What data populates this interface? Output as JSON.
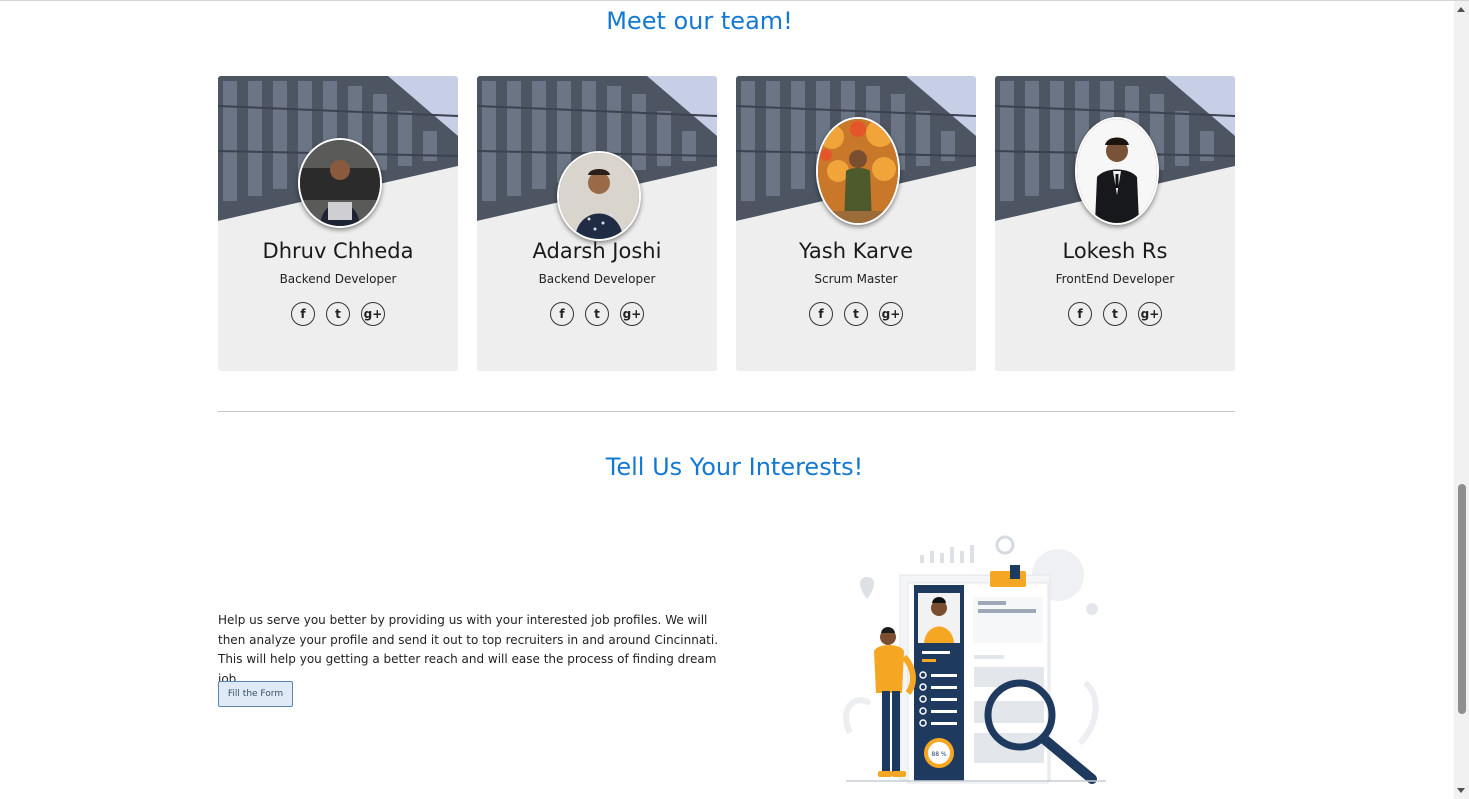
{
  "team": {
    "heading": "Meet our team!",
    "members": [
      {
        "name": "Dhruv Chheda",
        "role": "Backend Developer"
      },
      {
        "name": "Adarsh Joshi",
        "role": "Backend Developer"
      },
      {
        "name": "Yash Karve",
        "role": "Scrum Master"
      },
      {
        "name": "Lokesh Rs",
        "role": "FrontEnd Developer"
      }
    ],
    "social_glyphs": {
      "facebook": "f",
      "twitter": "t",
      "google_plus": "g+"
    }
  },
  "interests": {
    "heading": "Tell Us Your Interests!",
    "description": "Help us serve you better by providing us with your interested job profiles. We will then analyze your profile and send it out to top recruiters in and around Cincinnati. This will help you getting a better reach and will ease the process of finding dream job.",
    "button_label": "Fill the Form",
    "illustration_badge": "88 %"
  },
  "colors": {
    "accent": "#1479d2",
    "card_bg": "#eeeeee",
    "illustration_navy": "#1f3a5f",
    "illustration_orange": "#f5a623"
  },
  "icons": [
    "facebook-icon",
    "twitter-icon",
    "google-plus-icon",
    "magnifier-icon",
    "resume-illustration"
  ]
}
